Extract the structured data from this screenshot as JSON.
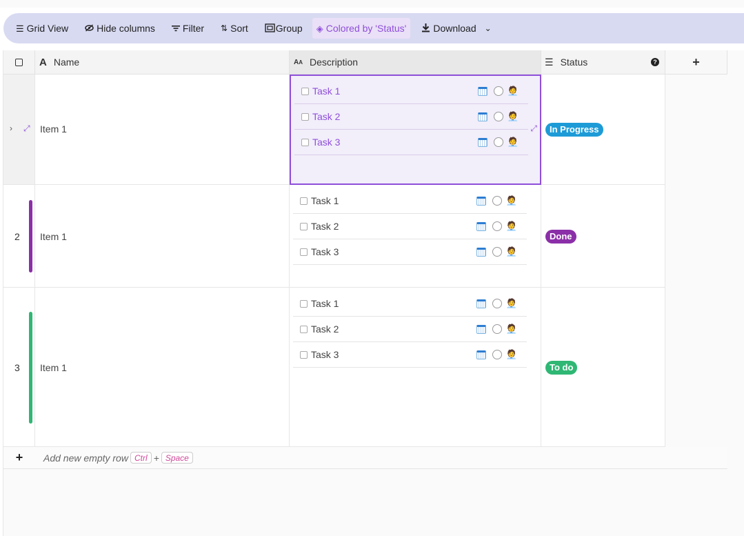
{
  "toolbar": {
    "grid_view": "Grid View",
    "hide_columns": "Hide columns",
    "filter": "Filter",
    "sort": "Sort",
    "group": "Group",
    "colored_by": "Colored by 'Status'",
    "download": "Download"
  },
  "columns": {
    "name": "Name",
    "description": "Description",
    "status": "Status",
    "add": "+"
  },
  "rows": [
    {
      "num": "",
      "name": "Item 1",
      "tasks": [
        "Task 1",
        "Task 2",
        "Task 3"
      ],
      "status": "In Progress",
      "status_color": "#1d9bd7",
      "bar_color": ""
    },
    {
      "num": "2",
      "name": "Item 1",
      "tasks": [
        "Task 1",
        "Task 2",
        "Task 3"
      ],
      "status": "Done",
      "status_color": "#8b2fa8",
      "bar_color": "#8b2fa8"
    },
    {
      "num": "3",
      "name": "Item 1",
      "tasks": [
        "Task 1",
        "Task 2",
        "Task 3"
      ],
      "status": "To do",
      "status_color": "#2fb774",
      "bar_color": "#2fb774"
    }
  ],
  "footer": {
    "add_row": "Add new empty row",
    "key1": "Ctrl",
    "plus": "+",
    "key2": "Space"
  },
  "colors": {
    "accent": "#8e4fd9",
    "toolbar_bg": "#d8daf2"
  }
}
